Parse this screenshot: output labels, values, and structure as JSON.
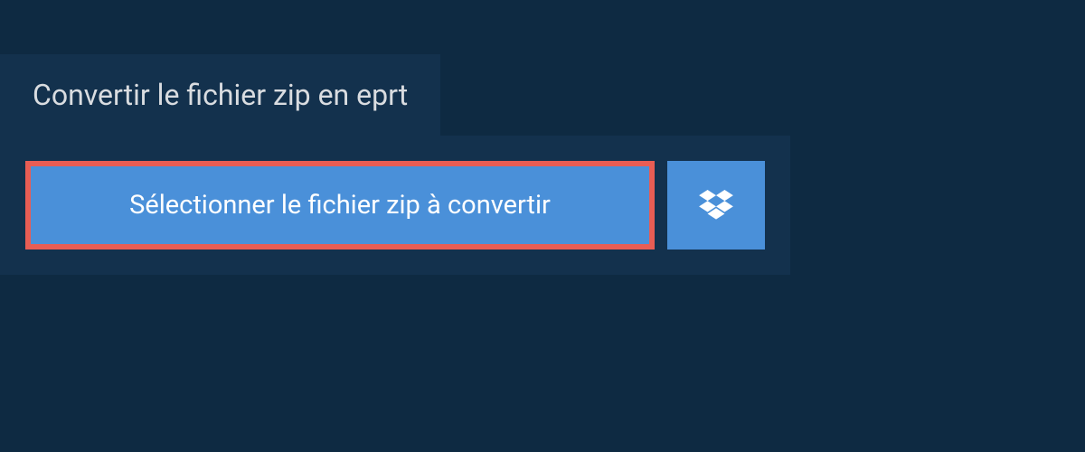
{
  "tab": {
    "title": "Convertir le fichier zip en eprt"
  },
  "actions": {
    "select_file_label": "Sélectionner le fichier zip à convertir"
  }
}
